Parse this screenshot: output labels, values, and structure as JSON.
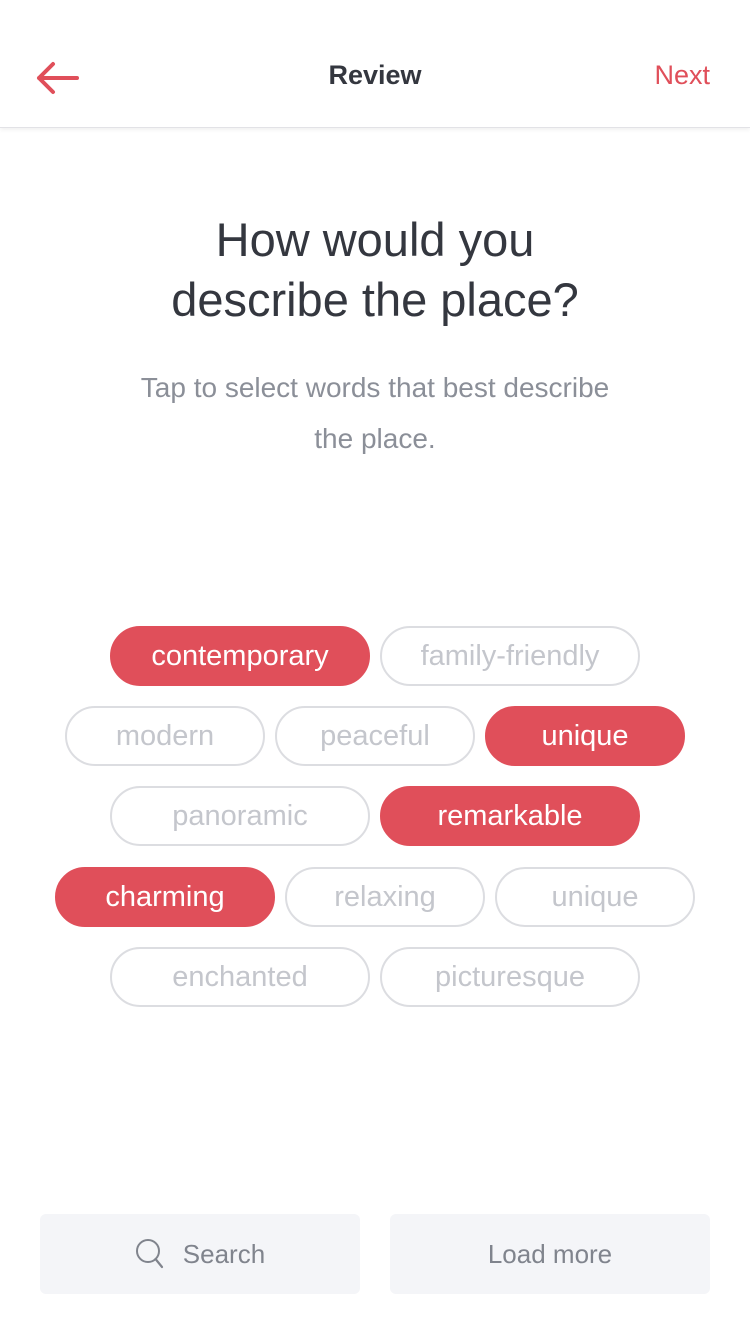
{
  "header": {
    "title": "Review",
    "next_label": "Next",
    "back_icon": "arrow-left-icon"
  },
  "question": {
    "line1": "How would you",
    "line2": "describe the place?"
  },
  "subtitle": {
    "line1": "Tap to select words that best describe",
    "line2": "the place."
  },
  "chips": [
    {
      "label": "contemporary",
      "selected": true
    },
    {
      "label": "family-friendly",
      "selected": false
    },
    {
      "label": "modern",
      "selected": false
    },
    {
      "label": "peaceful",
      "selected": false
    },
    {
      "label": "unique",
      "selected": true
    },
    {
      "label": "panoramic",
      "selected": false
    },
    {
      "label": "remarkable",
      "selected": true
    },
    {
      "label": "charming",
      "selected": true
    },
    {
      "label": "relaxing",
      "selected": false
    },
    {
      "label": "unique",
      "selected": false
    },
    {
      "label": "enchanted",
      "selected": false
    },
    {
      "label": "picturesque",
      "selected": false
    }
  ],
  "footer": {
    "search_label": "Search",
    "search_icon": "search-icon",
    "load_more_label": "Load more"
  },
  "colors": {
    "accent": "#e04f5a",
    "text_dark": "#34373f",
    "text_muted": "#8b8f98",
    "chip_border": "#dcdde1",
    "button_bg": "#f4f5f8"
  }
}
